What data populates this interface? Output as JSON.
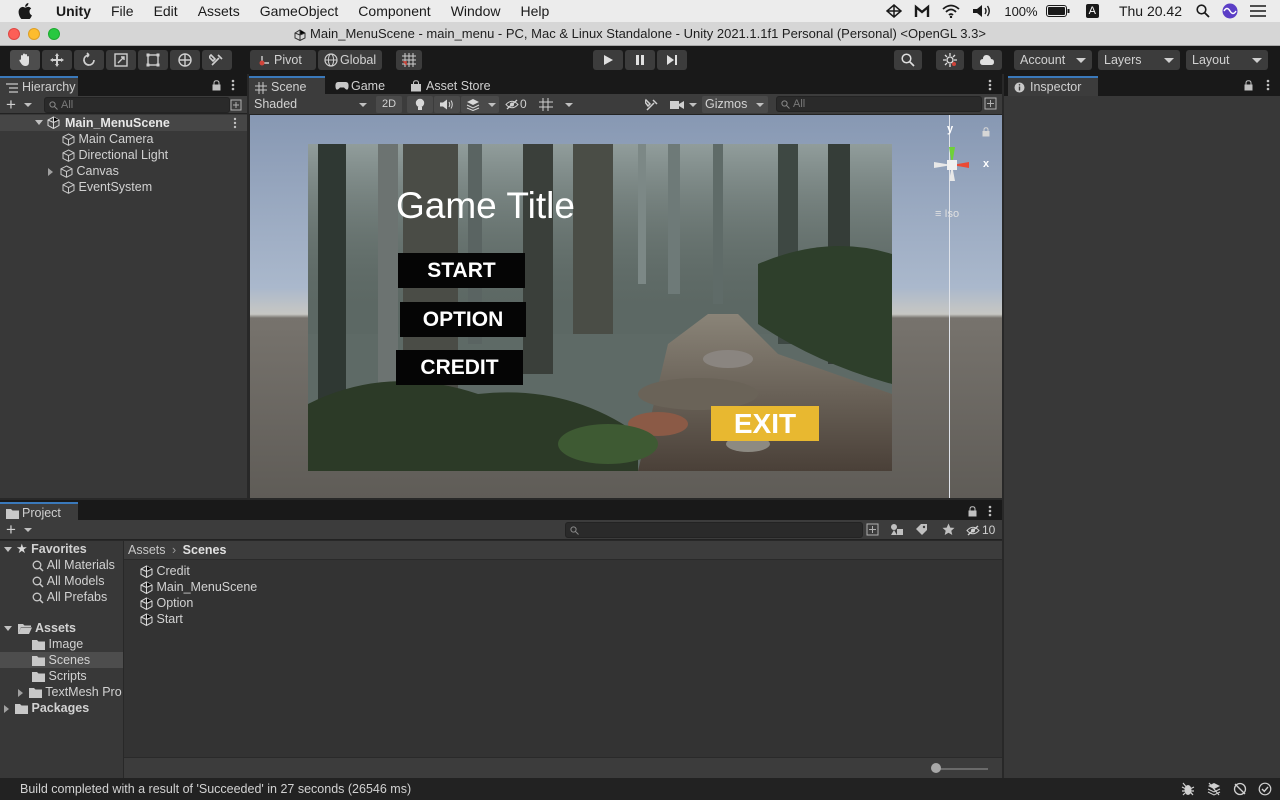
{
  "menubar": {
    "app": "Unity",
    "items": [
      "File",
      "Edit",
      "Assets",
      "GameObject",
      "Component",
      "Window",
      "Help"
    ],
    "battery": "100%",
    "input_source": "A",
    "clock": "Thu 20.42"
  },
  "window_title": "Main_MenuScene - main_menu - PC, Mac & Linux Standalone - Unity 2021.1.1f1 Personal (Personal) <OpenGL 3.3>",
  "toolbar": {
    "pivot": "Pivot",
    "global": "Global",
    "account": "Account",
    "layers": "Layers",
    "layout": "Layout"
  },
  "hierarchy": {
    "tab": "Hierarchy",
    "search_placeholder": "All",
    "scene": "Main_MenuScene",
    "items": [
      "Main Camera",
      "Directional Light",
      "Canvas",
      "EventSystem"
    ]
  },
  "scene_panel": {
    "tabs": [
      "Scene",
      "Game",
      "Asset Store"
    ],
    "shading": "Shaded",
    "mode_2d": "2D",
    "hidden_count": "0",
    "gizmos": "Gizmos",
    "search_placeholder": "All",
    "axis_y": "y",
    "axis_x": "x",
    "projection": "Iso"
  },
  "game_ui": {
    "title": "Game Title",
    "start": "START",
    "option": "OPTION",
    "credit": "CREDIT",
    "exit": "EXIT",
    "exit_color": "#e8b830"
  },
  "inspector": {
    "tab": "Inspector"
  },
  "project": {
    "tab": "Project",
    "hidden_count": "10",
    "favorites_label": "Favorites",
    "favorites": [
      "All Materials",
      "All Models",
      "All Prefabs"
    ],
    "assets_label": "Assets",
    "asset_folders": [
      "Image",
      "Scenes",
      "Scripts",
      "TextMesh Pro"
    ],
    "packages_label": "Packages",
    "breadcrumb": [
      "Assets",
      "Scenes"
    ],
    "files": [
      "Credit",
      "Main_MenuScene",
      "Option",
      "Start"
    ]
  },
  "status": "Build completed with a result of 'Succeeded' in 27 seconds (26546 ms)"
}
